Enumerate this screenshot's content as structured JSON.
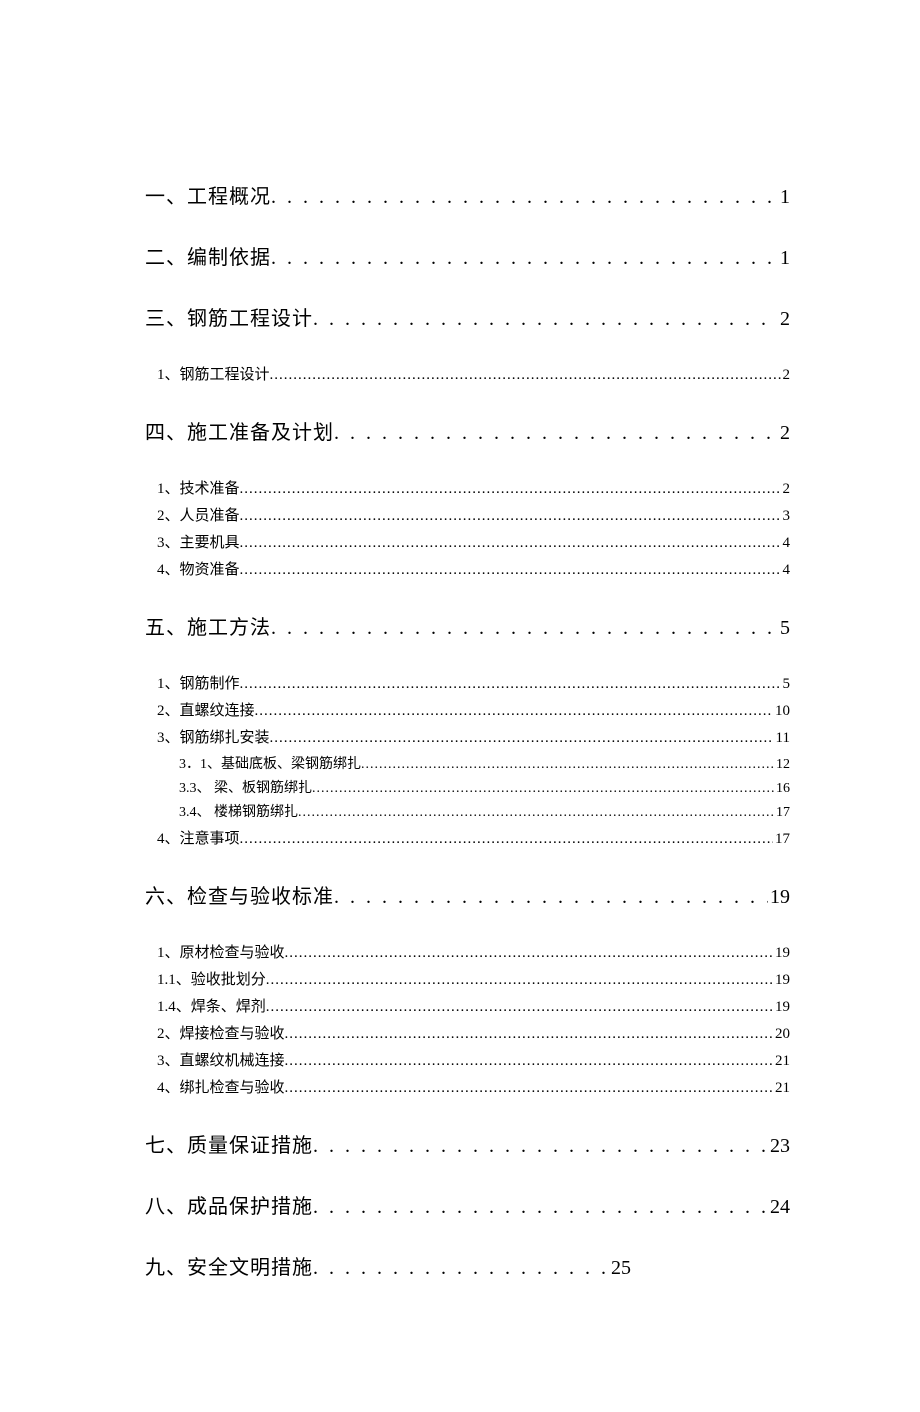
{
  "toc": {
    "s1": {
      "label": "一、工程概况",
      "page": "1"
    },
    "s2": {
      "label": "二、编制依据",
      "page": "1"
    },
    "s3": {
      "label": "三、钢筋工程设计",
      "page": "2"
    },
    "s3_1": {
      "label": "1、钢筋工程设计",
      "page": "2"
    },
    "s4": {
      "label": "四、施工准备及计划",
      "page": "2"
    },
    "s4_1": {
      "label": "1、技术准备",
      "page": "2"
    },
    "s4_2": {
      "label": "2、人员准备",
      "page": "3"
    },
    "s4_3": {
      "label": "3、主要机具",
      "page": "4"
    },
    "s4_4": {
      "label": "4、物资准备",
      "page": "4"
    },
    "s5": {
      "label": "五、施工方法",
      "page": "5"
    },
    "s5_1": {
      "label": "1、钢筋制作",
      "page": "5"
    },
    "s5_2": {
      "label": "2、直螺纹连接",
      "page": "10"
    },
    "s5_3": {
      "label": "3、钢筋绑扎安装",
      "page": "11"
    },
    "s5_3_1": {
      "label": "3．1、基础底板、梁钢筋绑扎",
      "page": "12"
    },
    "s5_3_3": {
      "label": "3.3、  梁、板钢筋绑扎",
      "page": "16"
    },
    "s5_3_4": {
      "label": "3.4、  楼梯钢筋绑扎",
      "page": "17"
    },
    "s5_4": {
      "label": "4、注意事项",
      "page": "17"
    },
    "s6": {
      "label": "六、检查与验收标准",
      "page": "19"
    },
    "s6_1": {
      "label": "1、原材检查与验收",
      "page": "19"
    },
    "s6_1_1": {
      "label": "1.1、验收批划分",
      "page": "19"
    },
    "s6_1_4": {
      "label": "1.4、焊条、焊剂",
      "page": "19"
    },
    "s6_2": {
      "label": "2、焊接检查与验收",
      "page": "20"
    },
    "s6_3": {
      "label": "3、直螺纹机械连接",
      "page": "21"
    },
    "s6_4": {
      "label": "4、绑扎检查与验收",
      "page": "21"
    },
    "s7": {
      "label": "七、质量保证措施",
      "page": "23"
    },
    "s8": {
      "label": "八、成品保护措施",
      "page": "24"
    },
    "s9": {
      "label": "九、安全文明措施",
      "page": "25"
    }
  }
}
